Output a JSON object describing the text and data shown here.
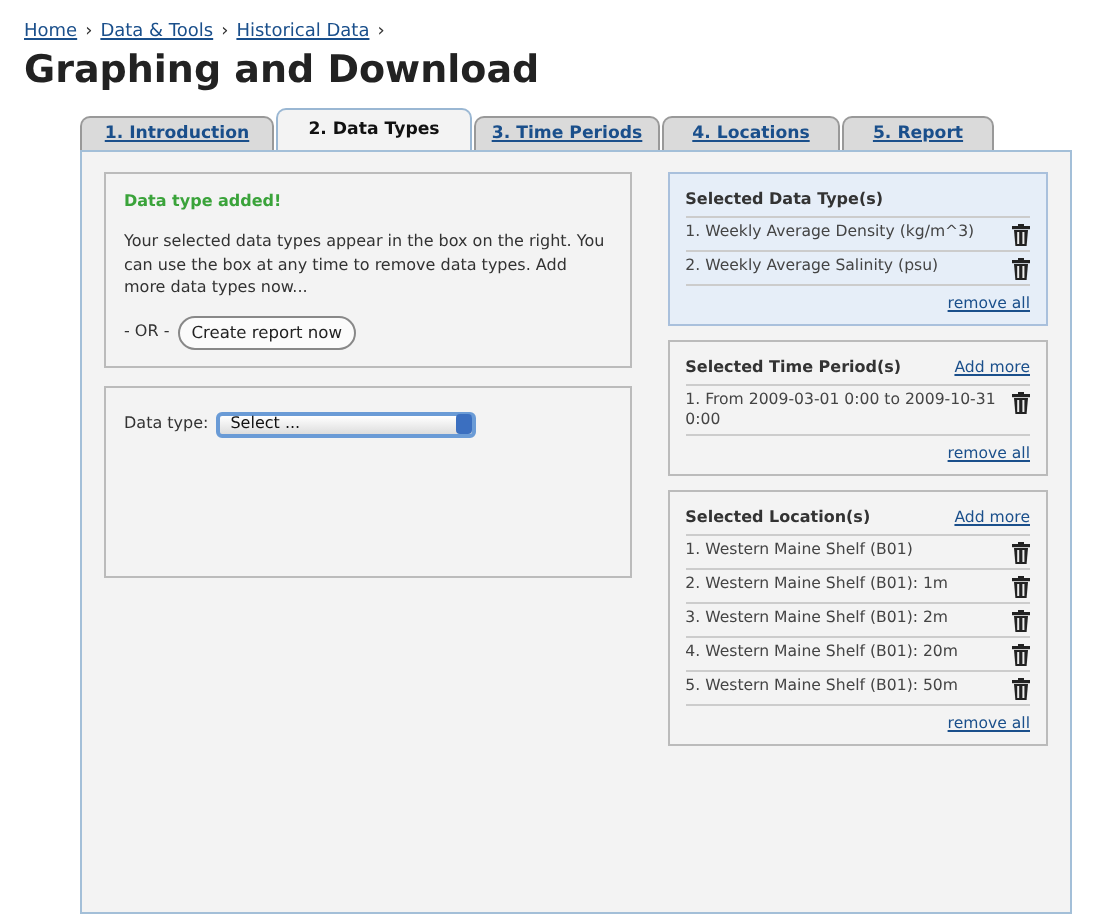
{
  "breadcrumb": [
    {
      "label": "Home"
    },
    {
      "label": "Data & Tools"
    },
    {
      "label": "Historical Data"
    }
  ],
  "breadcrumb_separator": "›",
  "title": "Graphing and Download",
  "tabs": [
    {
      "label": "1. Introduction",
      "selected": false
    },
    {
      "label": "2. Data Types",
      "selected": true
    },
    {
      "label": "3. Time Periods",
      "selected": false
    },
    {
      "label": "4. Locations",
      "selected": false
    },
    {
      "label": "5. Report",
      "selected": false
    }
  ],
  "message": {
    "heading": "Data type added!",
    "text": "Your selected data types appear in the box on the right. You can use the box at any time to remove data types. Add more data types now...",
    "or_label": "- OR -",
    "button": "Create report now"
  },
  "data_type_field": {
    "label": "Data type:",
    "value": "Select ..."
  },
  "selection_boxes": [
    {
      "title": "Selected Data Type(s)",
      "highlighted": true,
      "items": [
        "1. Weekly Average Density (kg/m^3)",
        "2. Weekly Average Salinity (psu)"
      ],
      "remove_all": "remove all"
    },
    {
      "title": "Selected Time Period(s)",
      "highlighted": false,
      "add_more": "Add more",
      "items": [
        "1. From 2009-03-01 0:00 to 2009-10-31 0:00"
      ],
      "remove_all": "remove all"
    },
    {
      "title": "Selected Location(s)",
      "highlighted": false,
      "add_more": "Add more",
      "items": [
        "1. Western Maine Shelf (B01)",
        "2. Western Maine Shelf (B01): 1m",
        "3. Western Maine Shelf (B01): 2m",
        "4. Western Maine Shelf (B01): 20m",
        "5. Western Maine Shelf (B01): 50m"
      ],
      "remove_all": "remove all"
    }
  ]
}
